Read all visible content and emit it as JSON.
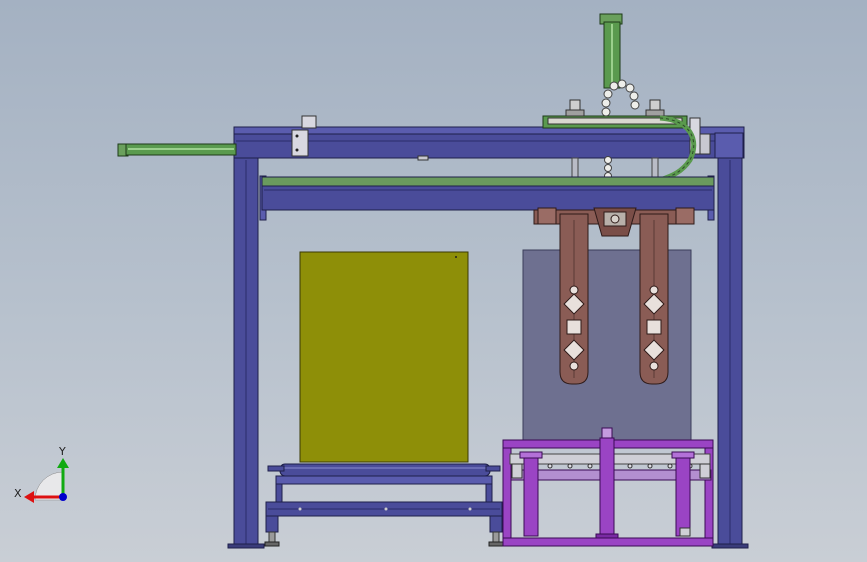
{
  "triad": {
    "x_label": "X",
    "y_label": "Y"
  },
  "colors": {
    "background_top": "#a4b1c2",
    "background_bottom": "#c9ced5",
    "frame_blue": "#4a4c9a",
    "frame_dark": "#2a2c6a",
    "cylinder_green": "#5a9a4e",
    "pallet_olive": "#8e8f08",
    "gripper_brown": "#8a5c55",
    "carton_gray": "#6e7090",
    "lifter_purple": "#9a44c4",
    "axis_x": "#d11",
    "axis_y": "#1a1",
    "axis_z": "#00c"
  }
}
